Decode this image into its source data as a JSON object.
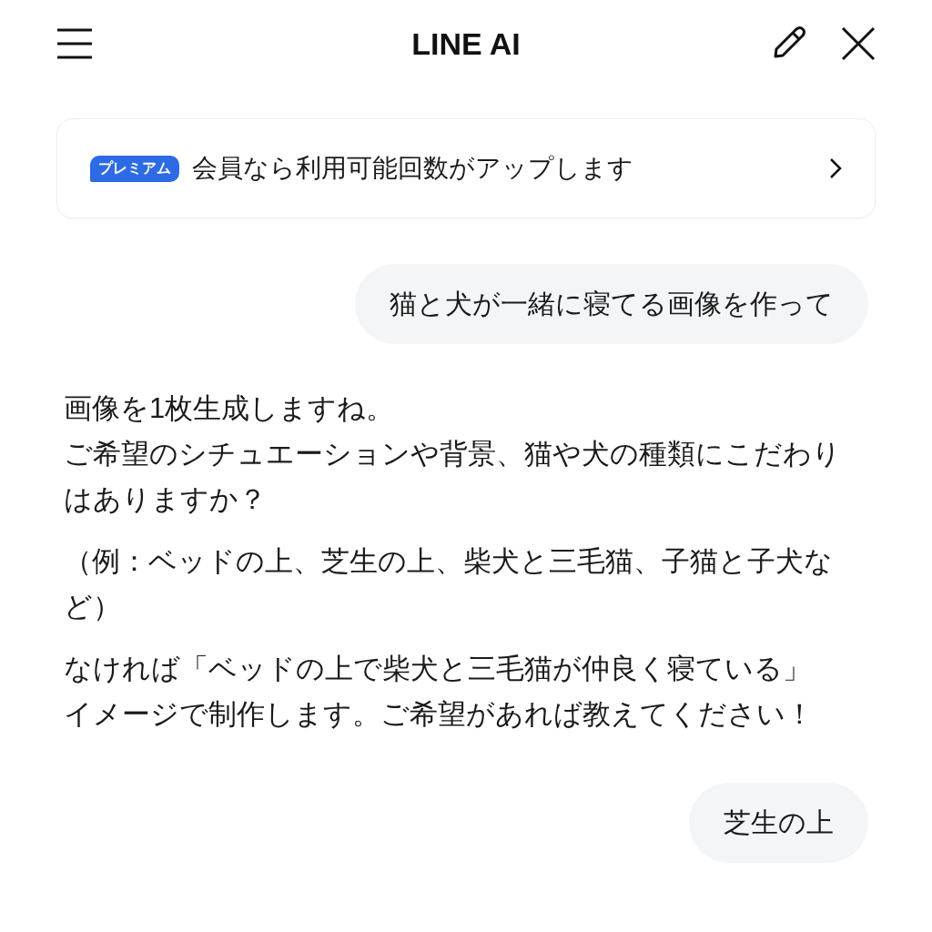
{
  "header": {
    "title": "LINE AI"
  },
  "banner": {
    "badge": "プレミアム",
    "text": "会員なら利用可能回数がアップします"
  },
  "messages": [
    {
      "kind": "user",
      "paragraphs": [
        [
          "猫と犬が一緒に寝てる画像を作って"
        ]
      ]
    },
    {
      "kind": "ai",
      "paragraphs": [
        [
          "画像を1枚生成しますね。",
          "ご希望のシチュエーションや背景、猫や犬の種類にこだわりはありますか？"
        ],
        [
          "（例：ベッドの上、芝生の上、柴犬と三毛猫、子猫と子犬など）"
        ],
        [
          "なければ「ベッドの上で柴犬と三毛猫が仲良く寝ている」",
          "イメージで制作します。ご希望があれば教えてください！"
        ]
      ]
    },
    {
      "kind": "user",
      "paragraphs": [
        [
          "芝生の上"
        ]
      ]
    }
  ]
}
